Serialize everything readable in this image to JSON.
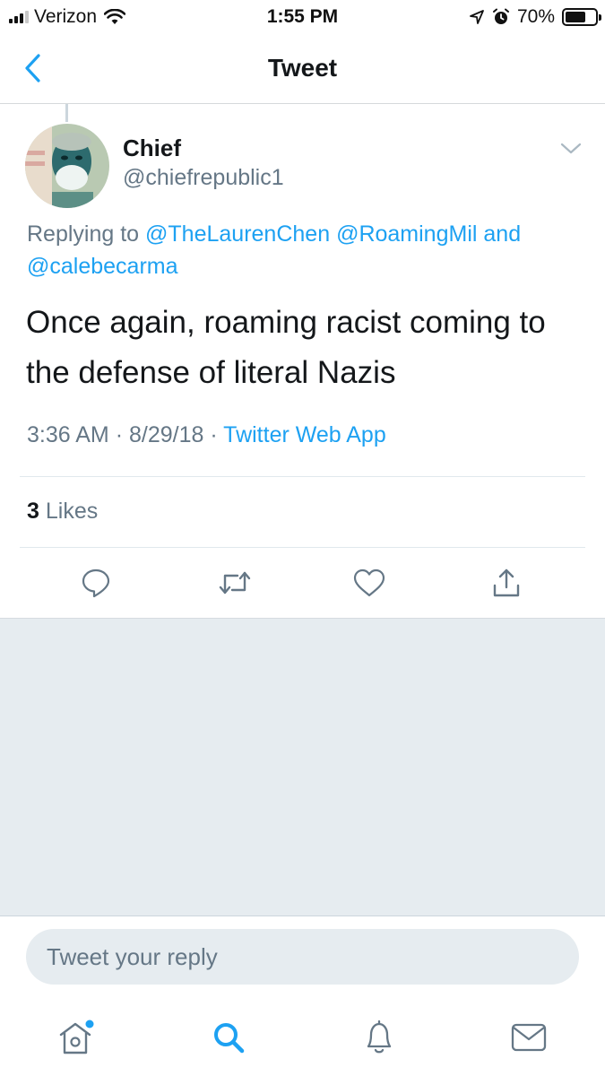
{
  "status_bar": {
    "carrier": "Verizon",
    "time": "1:55 PM",
    "battery_percent": "70%",
    "battery_level": 0.7,
    "icons": [
      "signal-icon",
      "wifi-icon",
      "location-icon",
      "alarm-icon",
      "battery-icon"
    ]
  },
  "nav": {
    "title": "Tweet",
    "back_icon": "chevron-left-icon"
  },
  "tweet": {
    "author_name": "Chief",
    "author_handle": "@chiefrepublic1",
    "replying_prefix": "Replying to",
    "mentions": [
      "@TheLaurenChen",
      "@RoamingMil",
      "@calebecarma"
    ],
    "mention_joiner": "and",
    "text": "Once again, roaming racist coming to the defense of literal Nazis",
    "time": "3:36 AM",
    "date": "8/29/18",
    "meta_separator": "·",
    "source": "Twitter Web App",
    "likes_count": "3",
    "likes_label": "Likes"
  },
  "actions": [
    "reply-icon",
    "retweet-icon",
    "like-icon",
    "share-icon"
  ],
  "reply_box": {
    "placeholder": "Tweet your reply"
  },
  "tab_bar": {
    "tabs": [
      "home-icon",
      "search-icon",
      "notifications-icon",
      "messages-icon"
    ],
    "active": "search-icon",
    "accent_color": "#1da1f2"
  },
  "colors": {
    "accent": "#1da1f2",
    "secondary_text": "#657786",
    "primary_text": "#14171a",
    "background_gray": "#e6ecf0"
  }
}
